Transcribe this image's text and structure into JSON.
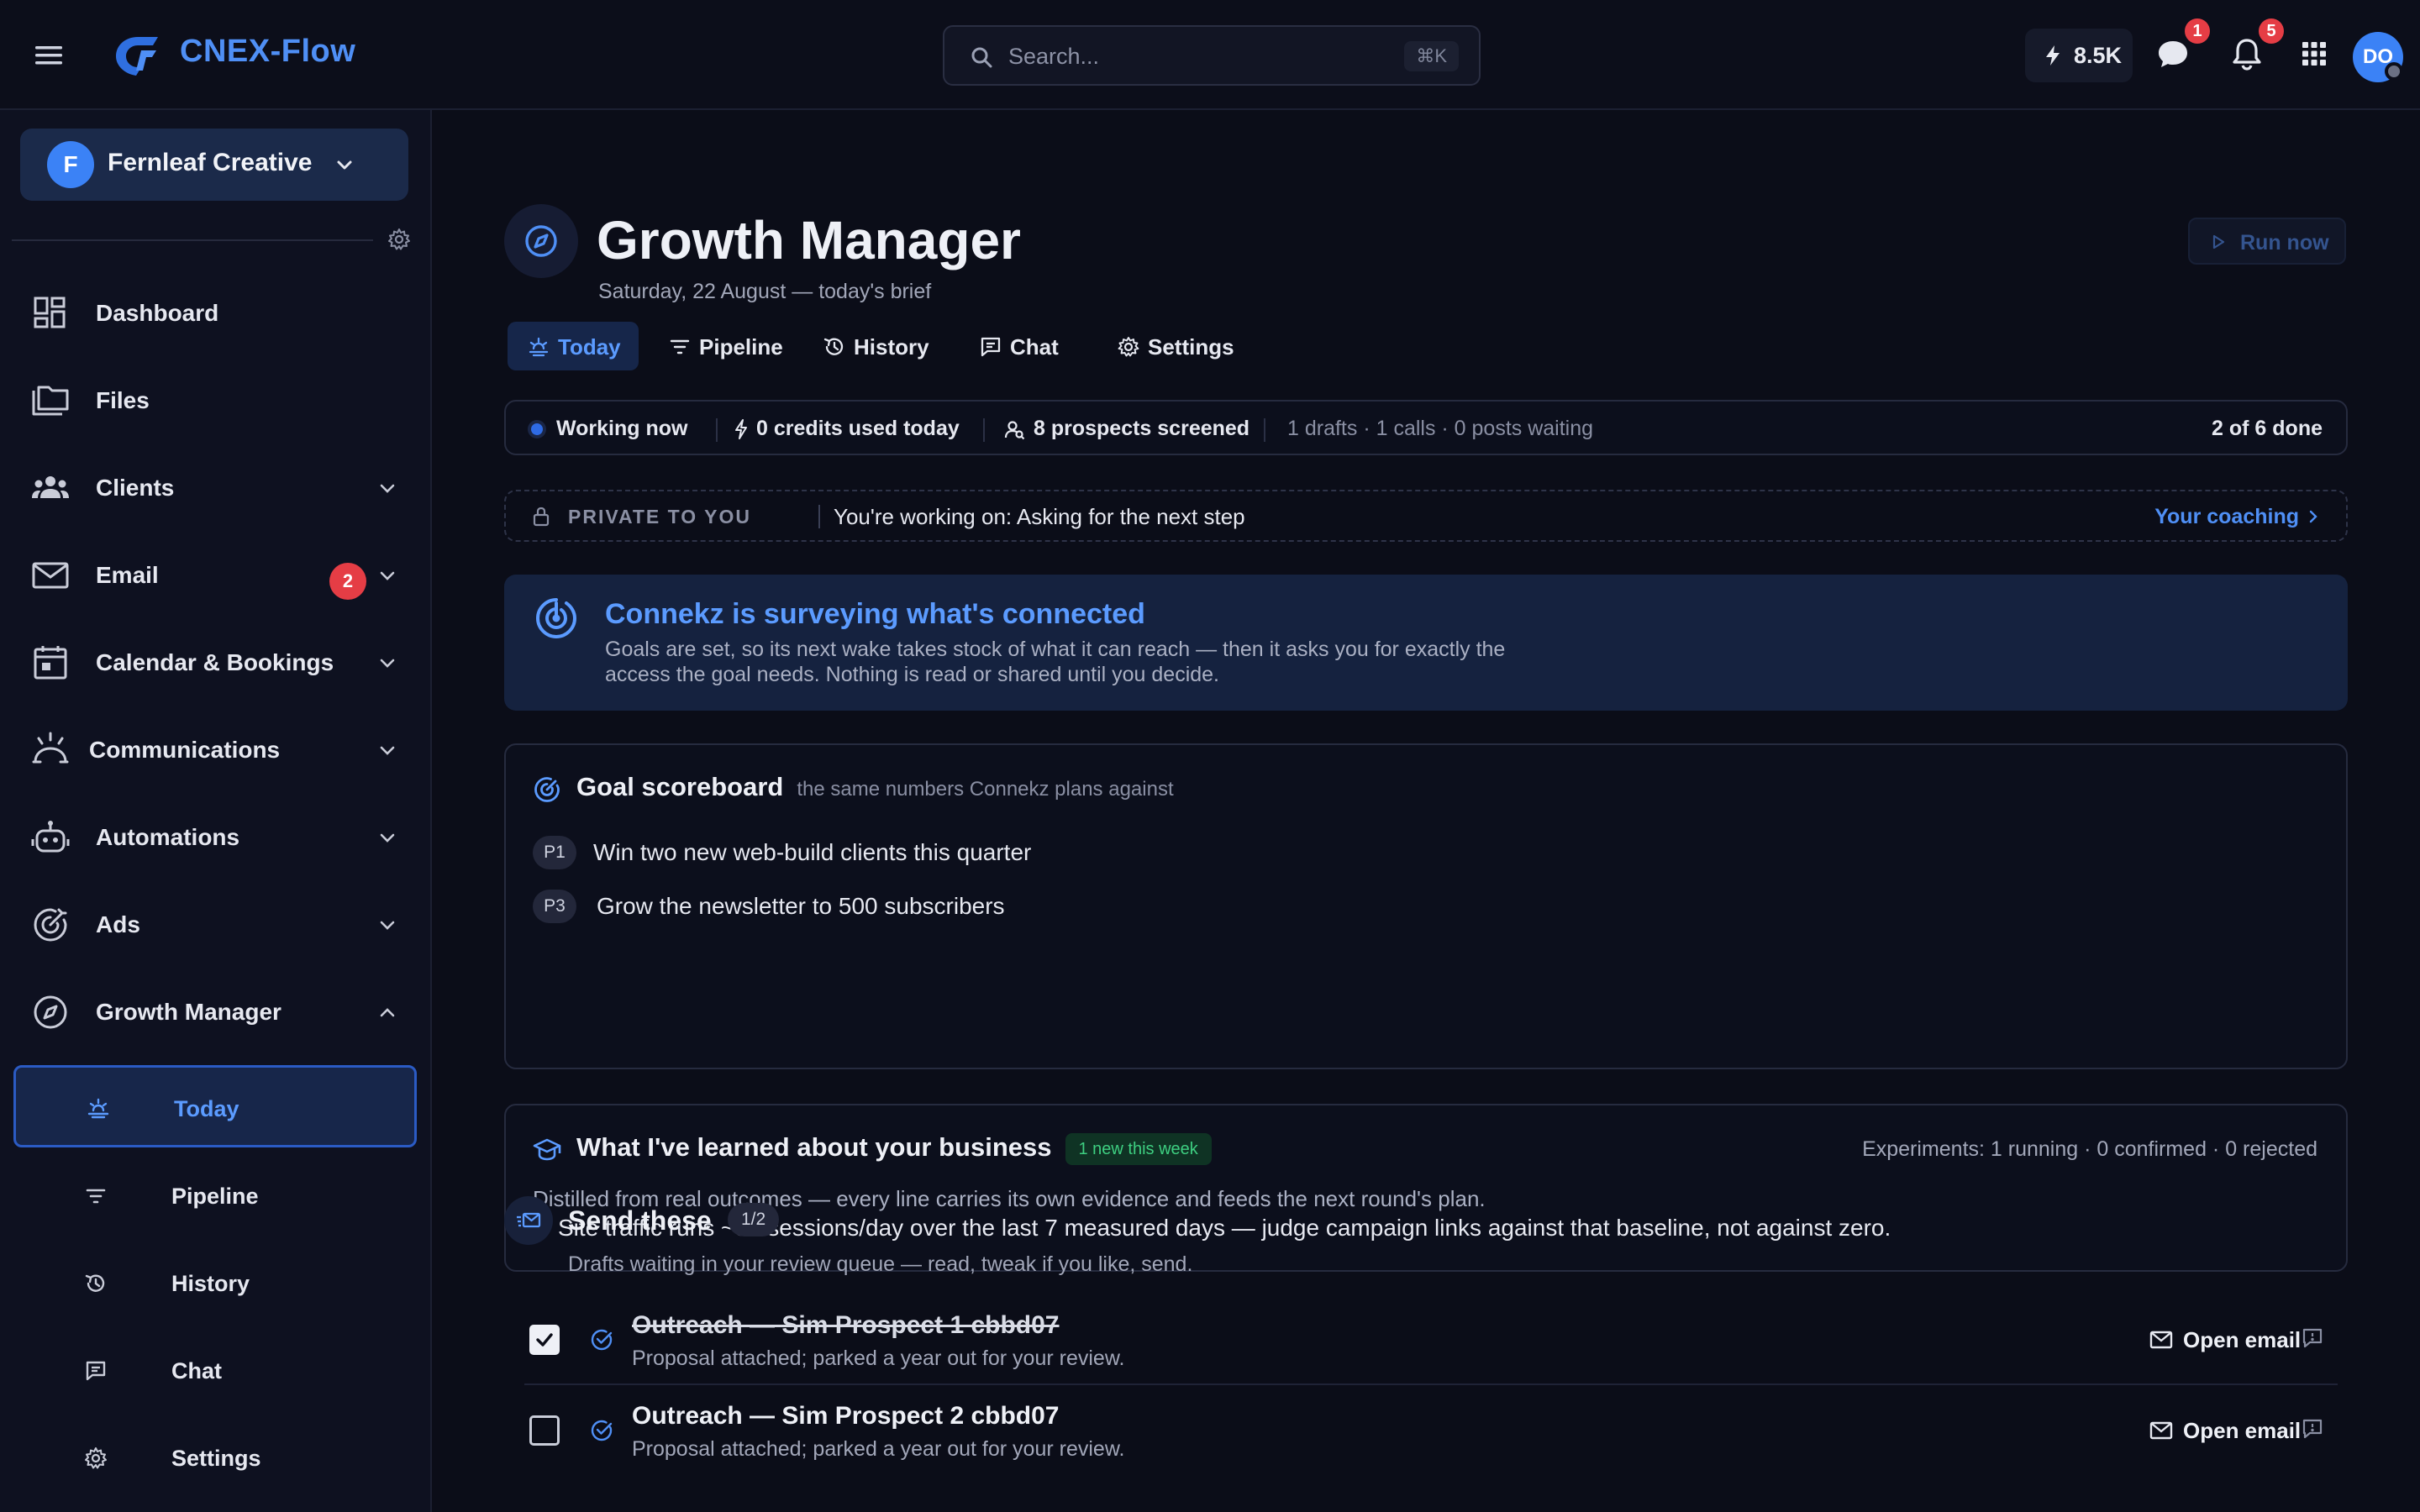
{
  "app": {
    "name": "CNEX-Flow",
    "brand_color": "#4f8ff5"
  },
  "topbar": {
    "search_placeholder": "Search...",
    "search_shortcut": "⌘K",
    "credits": "8.5K",
    "messages_badge": "1",
    "notifications_badge": "5",
    "avatar_initials": "DO"
  },
  "sidebar": {
    "workspace_initial": "F",
    "workspace_name": "Fernleaf Creative",
    "items": [
      {
        "label": "Dashboard",
        "icon": "dashboard-icon"
      },
      {
        "label": "Files",
        "icon": "files-icon"
      },
      {
        "label": "Clients",
        "icon": "clients-icon"
      },
      {
        "label": "Email",
        "icon": "mail-icon",
        "badge": "2"
      },
      {
        "label": "Calendar & Bookings",
        "icon": "calendar-icon"
      },
      {
        "label": "Communications",
        "icon": "communications-icon"
      },
      {
        "label": "Automations",
        "icon": "robot-icon"
      },
      {
        "label": "Ads",
        "icon": "target-icon"
      },
      {
        "label": "Growth Manager",
        "icon": "compass-icon"
      }
    ],
    "sub_items": [
      {
        "label": "Today",
        "icon": "sun-icon",
        "active": true
      },
      {
        "label": "Pipeline",
        "icon": "filter-icon"
      },
      {
        "label": "History",
        "icon": "history-icon"
      },
      {
        "label": "Chat",
        "icon": "chat-icon"
      },
      {
        "label": "Settings",
        "icon": "gear-icon"
      }
    ]
  },
  "header": {
    "title": "Growth Manager",
    "subtitle": "Saturday, 22 August — today's brief",
    "run_now": "Run now"
  },
  "tabs": [
    {
      "label": "Today",
      "active": true
    },
    {
      "label": "Pipeline"
    },
    {
      "label": "History"
    },
    {
      "label": "Chat"
    },
    {
      "label": "Settings"
    }
  ],
  "status": {
    "working": "Working now",
    "credits": "0 credits used today",
    "prospects": "8 prospects screened",
    "queue": "1 drafts · 1 calls · 0 posts waiting",
    "progress": "2 of 6 done"
  },
  "private": {
    "tag": "PRIVATE TO YOU",
    "text": "You're working on: Asking for the next step",
    "link": "Your coaching"
  },
  "survey": {
    "title": "Connekz is surveying what's connected",
    "body": "Goals are set, so its next wake takes stock of what it can reach — then it asks you for exactly the access the goal needs. Nothing is read or shared until you decide."
  },
  "goals": {
    "title": "Goal scoreboard",
    "subtitle": "the same numbers Connekz plans against",
    "items": [
      {
        "priority": "P1",
        "text": "Win two new web-build clients this quarter"
      },
      {
        "priority": "P3",
        "text": "Grow the newsletter to 500 subscribers"
      }
    ]
  },
  "learned": {
    "title": "What I've learned about your business",
    "badge": "1 new this week",
    "experiments": "Experiments: 1 running · 0 confirmed · 0 rejected",
    "description": "Distilled from real outcomes — every line carries its own evidence and feeds the next round's plan.",
    "fact": "Site traffic runs ~88 sessions/day over the last 7 measured days — judge campaign links against that baseline, not against zero."
  },
  "send": {
    "title": "Send these",
    "count": "1/2",
    "subtitle": "Drafts waiting in your review queue — read, tweak if you like, send.",
    "items": [
      {
        "title": "Outreach — Sim Prospect 1 cbbd07",
        "subtitle": "Proposal attached; parked a year out for your review.",
        "checked": true,
        "action": "Open email"
      },
      {
        "title": "Outreach — Sim Prospect 2 cbbd07",
        "subtitle": "Proposal attached; parked a year out for your review.",
        "checked": false,
        "action": "Open email"
      }
    ]
  }
}
